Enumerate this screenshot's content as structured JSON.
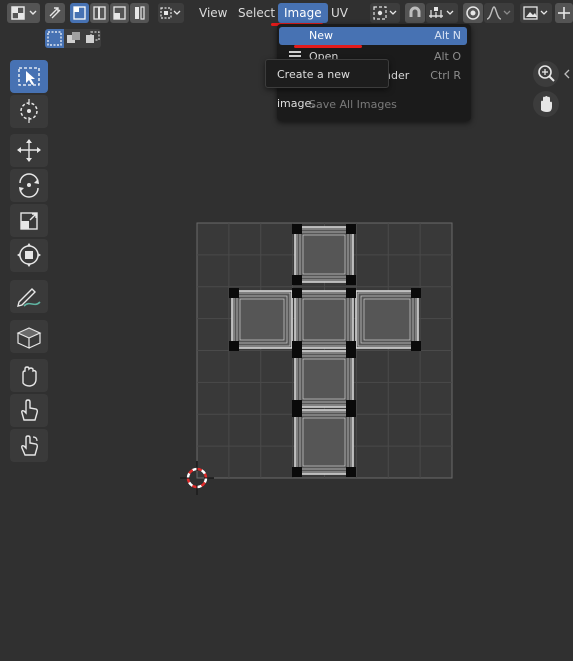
{
  "header": {
    "menus": {
      "view": "View",
      "select": "Select",
      "image": "Image",
      "uv": "UV"
    }
  },
  "image_menu": {
    "items": [
      {
        "label": "New",
        "shortcut": "Alt N"
      },
      {
        "label": "Open",
        "shortcut": "Alt O"
      },
      {
        "label": "nder",
        "shortcut": "Ctrl R"
      },
      {
        "label": "Save All Images",
        "shortcut": ""
      }
    ]
  },
  "tooltip": {
    "text": "Create a new image."
  },
  "colors": {
    "accent": "#4772b3",
    "annotation_red": "#e31b1b",
    "background": "#303030",
    "menu_background": "#1b1b1b"
  },
  "icons": {
    "toolbar": [
      "select-box-icon",
      "cursor-icon",
      "move-icon",
      "rotate-icon",
      "scale-icon",
      "transform-icon",
      "annotate-icon",
      "uv-sculpt-grab-icon",
      "grab-hand-icon",
      "pinch-icon",
      "relax-icon"
    ],
    "navigation": [
      "zoom-icon",
      "pan-hand-icon"
    ]
  }
}
